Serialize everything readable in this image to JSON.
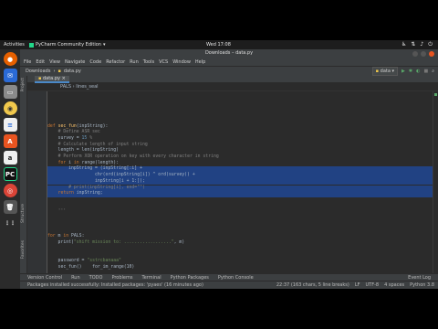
{
  "topbar": {
    "activities": "Activities",
    "app_name": "PyCharm Community Edition",
    "clock": "Wed 17:08"
  },
  "window": {
    "title": "Downloads – data.py"
  },
  "menu": [
    "File",
    "Edit",
    "View",
    "Navigate",
    "Code",
    "Refactor",
    "Run",
    "Tools",
    "VCS",
    "Window",
    "Help"
  ],
  "navbar": {
    "crumbs": [
      "Downloads",
      "data.py"
    ],
    "run_config": "data"
  },
  "tab": {
    "label": "data.py"
  },
  "breadcrumb": "PALS › lines_seal",
  "code_lines": [
    {
      "n": "",
      "html": ""
    },
    {
      "n": "",
      "html": ""
    },
    {
      "n": "",
      "html": ""
    },
    {
      "n": "",
      "html": ""
    },
    {
      "n": "",
      "html": ""
    },
    {
      "n": "",
      "html": "<span class='kw'>def</span> <span class='fn'>sec_fun</span>(inpString):"
    },
    {
      "n": "",
      "html": "    <span class='cm'># Define ASR sec</span>"
    },
    {
      "n": "",
      "html": "    survey = <span class='nm'>15</span> <span class='cm'>%</span>"
    },
    {
      "n": "",
      "html": "    <span class='cm'># Calculate length of input string</span>"
    },
    {
      "n": "",
      "html": "    length = len(inpString)"
    },
    {
      "n": "",
      "html": "    <span class='cm'># Perform XOR operation on key with every character in string</span>"
    },
    {
      "n": "",
      "html": "    <span class='kw'>for</span> i <span class='kw'>in</span> range(length):"
    },
    {
      "n": "",
      "html": "        inpString = (inpString[:i] +",
      "sel": true
    },
    {
      "n": "",
      "html": "                  chr(ord(inpString[i]) ^ ord(survey)) +",
      "sel": true
    },
    {
      "n": "",
      "html": "                  inpString[i + 1:]);",
      "sel": true
    },
    {
      "n": "",
      "html": "        <span class='cm'># print(inpString[i], end=\"\")</span>",
      "sel": true
    },
    {
      "n": "",
      "html": "    <span class='kw'>return</span> inpString;",
      "sel": true
    },
    {
      "n": "",
      "html": ""
    },
    {
      "n": "",
      "html": ""
    },
    {
      "n": "",
      "html": "    <span class='cm'>'''</span>"
    },
    {
      "n": "",
      "html": ""
    },
    {
      "n": "",
      "html": ""
    },
    {
      "n": "",
      "html": ""
    },
    {
      "n": "",
      "html": "<span class='kw'>for</span> m <span class='kw'>in</span> PALS:"
    },
    {
      "n": "",
      "html": "    print(<span class='st'>\"shift mission to: ..................\"</span>, m)"
    },
    {
      "n": "",
      "html": ""
    },
    {
      "n": "",
      "html": ""
    },
    {
      "n": "",
      "html": "    password = <span class='st'>\"sstrcbanaaa\"</span>"
    },
    {
      "n": "",
      "html": "    sec_fun()    for_im_range(10)"
    }
  ],
  "bottom_tabs": [
    "Version Control",
    "Run",
    "TODO",
    "Problems",
    "Terminal",
    "Python Packages",
    "Python Console"
  ],
  "event_log": "Event Log",
  "status": {
    "message": "Packages installed successfully: Installed packages: 'pyaes' (16 minutes ago)",
    "position": "22:37 (163 chars, 5 line breaks)",
    "line_sep": "LF",
    "encoding": "UTF-8",
    "indent": "4 spaces",
    "interpreter": "Python 3.8"
  }
}
